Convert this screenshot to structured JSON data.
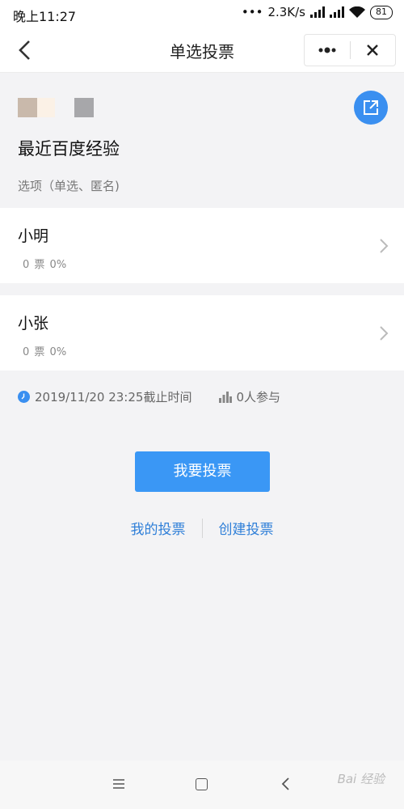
{
  "status_bar": {
    "time": "晚上11:27",
    "network_speed": "2.3K/s",
    "battery": "81"
  },
  "nav": {
    "title": "单选投票",
    "back_icon": "chevron-left-icon",
    "more_icon": "more-dots-icon",
    "close_icon": "close-icon"
  },
  "vote": {
    "title": "最近百度经验",
    "subtitle": "选项（单选、匿名)",
    "share_icon": "share-external-icon",
    "options": [
      {
        "name": "小明",
        "votes": "0 票",
        "percent": "0%"
      },
      {
        "name": "小张",
        "votes": "0 票",
        "percent": "0%"
      }
    ],
    "deadline": "2019/11/20 23:25截止时间",
    "participants": "0人参与"
  },
  "actions": {
    "vote_button": "我要投票",
    "my_votes_link": "我的投票",
    "create_vote_link": "创建投票"
  },
  "system_nav": {
    "watermark": "Bai 经验"
  },
  "colors": {
    "accent": "#3a97f5",
    "link": "#2f7fd8",
    "background": "#f3f3f5"
  }
}
